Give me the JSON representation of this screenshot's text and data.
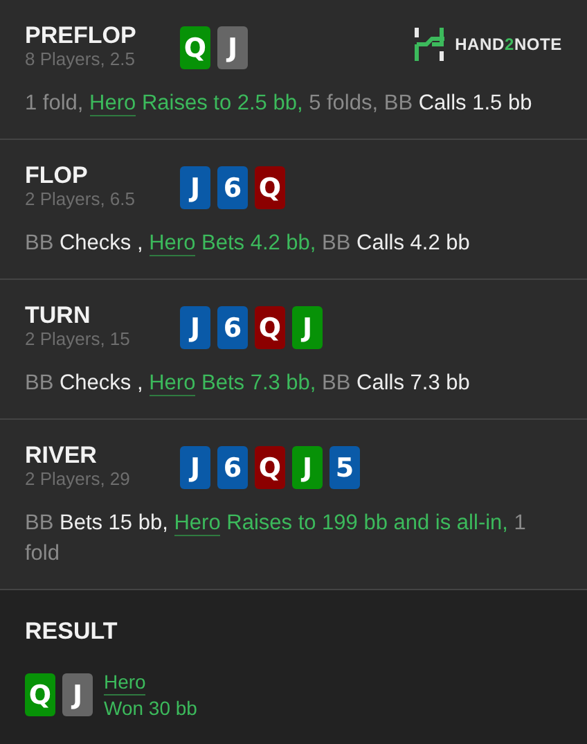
{
  "logo": {
    "parts": [
      {
        "text": "HAND",
        "accent": false
      },
      {
        "text": "2",
        "accent": true
      },
      {
        "text": "NOTE",
        "accent": false
      }
    ]
  },
  "streets": [
    {
      "name": "PREFLOP",
      "subtitle": "8 Players, 2.5",
      "cards": [
        {
          "rank": "Q",
          "color": "#079207"
        },
        {
          "rank": "J",
          "color": "#666666"
        }
      ],
      "actions": [
        {
          "kind": "muted",
          "text": "1 fold, "
        },
        {
          "kind": "hero_name",
          "text": "Hero"
        },
        {
          "kind": "hero",
          "text": " Raises to 2.5 bb, "
        },
        {
          "kind": "muted",
          "text": "5 folds, BB "
        },
        {
          "kind": "bright",
          "text": "Calls 1.5 bb"
        }
      ]
    },
    {
      "name": "FLOP",
      "subtitle": "2 Players, 6.5",
      "cards": [
        {
          "rank": "J",
          "color": "#0a5aa8"
        },
        {
          "rank": "6",
          "color": "#0a5aa8"
        },
        {
          "rank": "Q",
          "color": "#8c0000"
        }
      ],
      "actions": [
        {
          "kind": "muted",
          "text": "BB "
        },
        {
          "kind": "bright",
          "text": "Checks , "
        },
        {
          "kind": "hero_name",
          "text": "Hero"
        },
        {
          "kind": "hero",
          "text": " Bets 4.2 bb, "
        },
        {
          "kind": "muted",
          "text": "BB "
        },
        {
          "kind": "bright",
          "text": "Calls 4.2 bb"
        }
      ]
    },
    {
      "name": "TURN",
      "subtitle": "2 Players, 15",
      "cards": [
        {
          "rank": "J",
          "color": "#0a5aa8"
        },
        {
          "rank": "6",
          "color": "#0a5aa8"
        },
        {
          "rank": "Q",
          "color": "#8c0000"
        },
        {
          "rank": "J",
          "color": "#079207"
        }
      ],
      "actions": [
        {
          "kind": "muted",
          "text": "BB "
        },
        {
          "kind": "bright",
          "text": "Checks , "
        },
        {
          "kind": "hero_name",
          "text": "Hero"
        },
        {
          "kind": "hero",
          "text": " Bets 7.3 bb, "
        },
        {
          "kind": "muted",
          "text": "BB "
        },
        {
          "kind": "bright",
          "text": "Calls 7.3 bb"
        }
      ]
    },
    {
      "name": "RIVER",
      "subtitle": "2 Players, 29",
      "cards": [
        {
          "rank": "J",
          "color": "#0a5aa8"
        },
        {
          "rank": "6",
          "color": "#0a5aa8"
        },
        {
          "rank": "Q",
          "color": "#8c0000"
        },
        {
          "rank": "J",
          "color": "#079207"
        },
        {
          "rank": "5",
          "color": "#0a5aa8"
        }
      ],
      "actions": [
        {
          "kind": "muted",
          "text": "BB "
        },
        {
          "kind": "bright",
          "text": "Bets 15 bb, "
        },
        {
          "kind": "hero_name",
          "text": "Hero"
        },
        {
          "kind": "hero",
          "text": " Raises to 199 bb and is all-in, "
        },
        {
          "kind": "muted",
          "text": "1 fold"
        }
      ]
    }
  ],
  "result": {
    "title": "RESULT",
    "cards": [
      {
        "rank": "Q",
        "color": "#079207"
      },
      {
        "rank": "J",
        "color": "#666666"
      }
    ],
    "player": "Hero",
    "outcome": "Won 30 bb"
  }
}
